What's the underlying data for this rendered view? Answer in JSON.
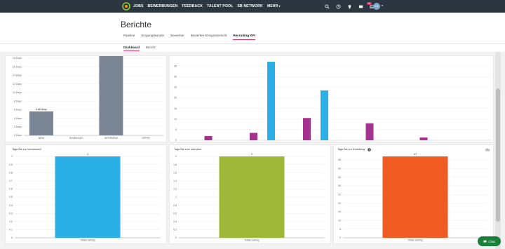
{
  "nav": {
    "items": [
      "JOBS",
      "BEWERBUNGEN",
      "FEEDBACK",
      "TALENT POOL",
      "SB NETWORK",
      "MEHR"
    ],
    "badge_count": "14",
    "avatar_initials": "LB"
  },
  "page": {
    "title": "Berichte"
  },
  "tabs": [
    "Pipeline",
    "Eingangskanale",
    "Bewerber",
    "Bewerber-Ereignisbericht",
    "Recruiting KPI"
  ],
  "subtabs": [
    "Dashboard",
    "Bericht"
  ],
  "colors": {
    "accent": "#d6336c",
    "topbar": "#2c3640",
    "gray_bar": "#7a8594",
    "blue": "#2ab0e6",
    "purple": "#a4328f",
    "green": "#9fb83a",
    "orange": "#f05a23"
  },
  "chat": {
    "label": "Chat"
  },
  "chart_data": [
    {
      "type": "bar",
      "title": "",
      "categories": [
        "NEW",
        "SHORTLIST",
        "INTERVIEW",
        "OFFER"
      ],
      "values": [
        5.6,
        0,
        30.5,
        0
      ],
      "data_labels": [
        "5.66 Days",
        "",
        "",
        ""
      ],
      "ylim": [
        0,
        16
      ],
      "ytick_labels": [
        "0 Days",
        "2 Days",
        "4 Days",
        "6 Days",
        "8 Days",
        "10 Days",
        "12 Days",
        "14 Days",
        "16 Days",
        "18 Days"
      ],
      "color": "#7a8594"
    },
    {
      "type": "bar",
      "title": "",
      "yticks": [
        0,
        5,
        10,
        15,
        20,
        25,
        30,
        35
      ],
      "ylim": [
        0,
        38
      ],
      "bars": [
        {
          "group": 1,
          "color": "#a4328f",
          "value": 2
        },
        {
          "group": 2,
          "color": "#a4328f",
          "value": 3.5
        },
        {
          "group": 2,
          "color": "#2ab0e6",
          "value": 37
        },
        {
          "group": 3,
          "color": "#a4328f",
          "value": 10.5
        },
        {
          "group": 3,
          "color": "#2ab0e6",
          "value": 23.5
        },
        {
          "group": 4,
          "color": "#a4328f",
          "value": 8
        },
        {
          "group": 5,
          "color": "#a4328f",
          "value": 1.3
        }
      ]
    },
    {
      "type": "bar",
      "title": "Tage Bis zur Vorauswahl",
      "categories": [
        "Tobias Lahring"
      ],
      "values": [
        1
      ],
      "data_labels": [
        "1"
      ],
      "ylim": [
        0,
        1
      ],
      "yticks": [
        "0",
        "0.1",
        "0.2",
        "0.3",
        "0.4",
        "0.5",
        "0.6",
        "0.7",
        "0.8",
        "0.9",
        "1"
      ],
      "color": "#2ab0e6"
    },
    {
      "type": "bar",
      "title": "Tage Bis zum Interview",
      "categories": [
        "Tobias Lahring"
      ],
      "values": [
        2
      ],
      "data_labels": [
        "2"
      ],
      "ylim": [
        0,
        2
      ],
      "yticks": [
        "0",
        "0.2",
        "0.4",
        "0.6",
        "0.8",
        "1",
        "1.2",
        "1.4",
        "1.6",
        "1.8",
        "2"
      ],
      "color": "#9fb83a"
    },
    {
      "type": "bar",
      "title": "Tage Bis zur Erstellung",
      "categories": [
        "Tobias Lahring"
      ],
      "values": [
        47
      ],
      "data_labels": [
        "47"
      ],
      "ylim": [
        0,
        47
      ],
      "yticks": [
        "0",
        "5",
        "10",
        "15",
        "20",
        "25",
        "30",
        "35",
        "40",
        "45"
      ],
      "color": "#f05a23"
    }
  ]
}
